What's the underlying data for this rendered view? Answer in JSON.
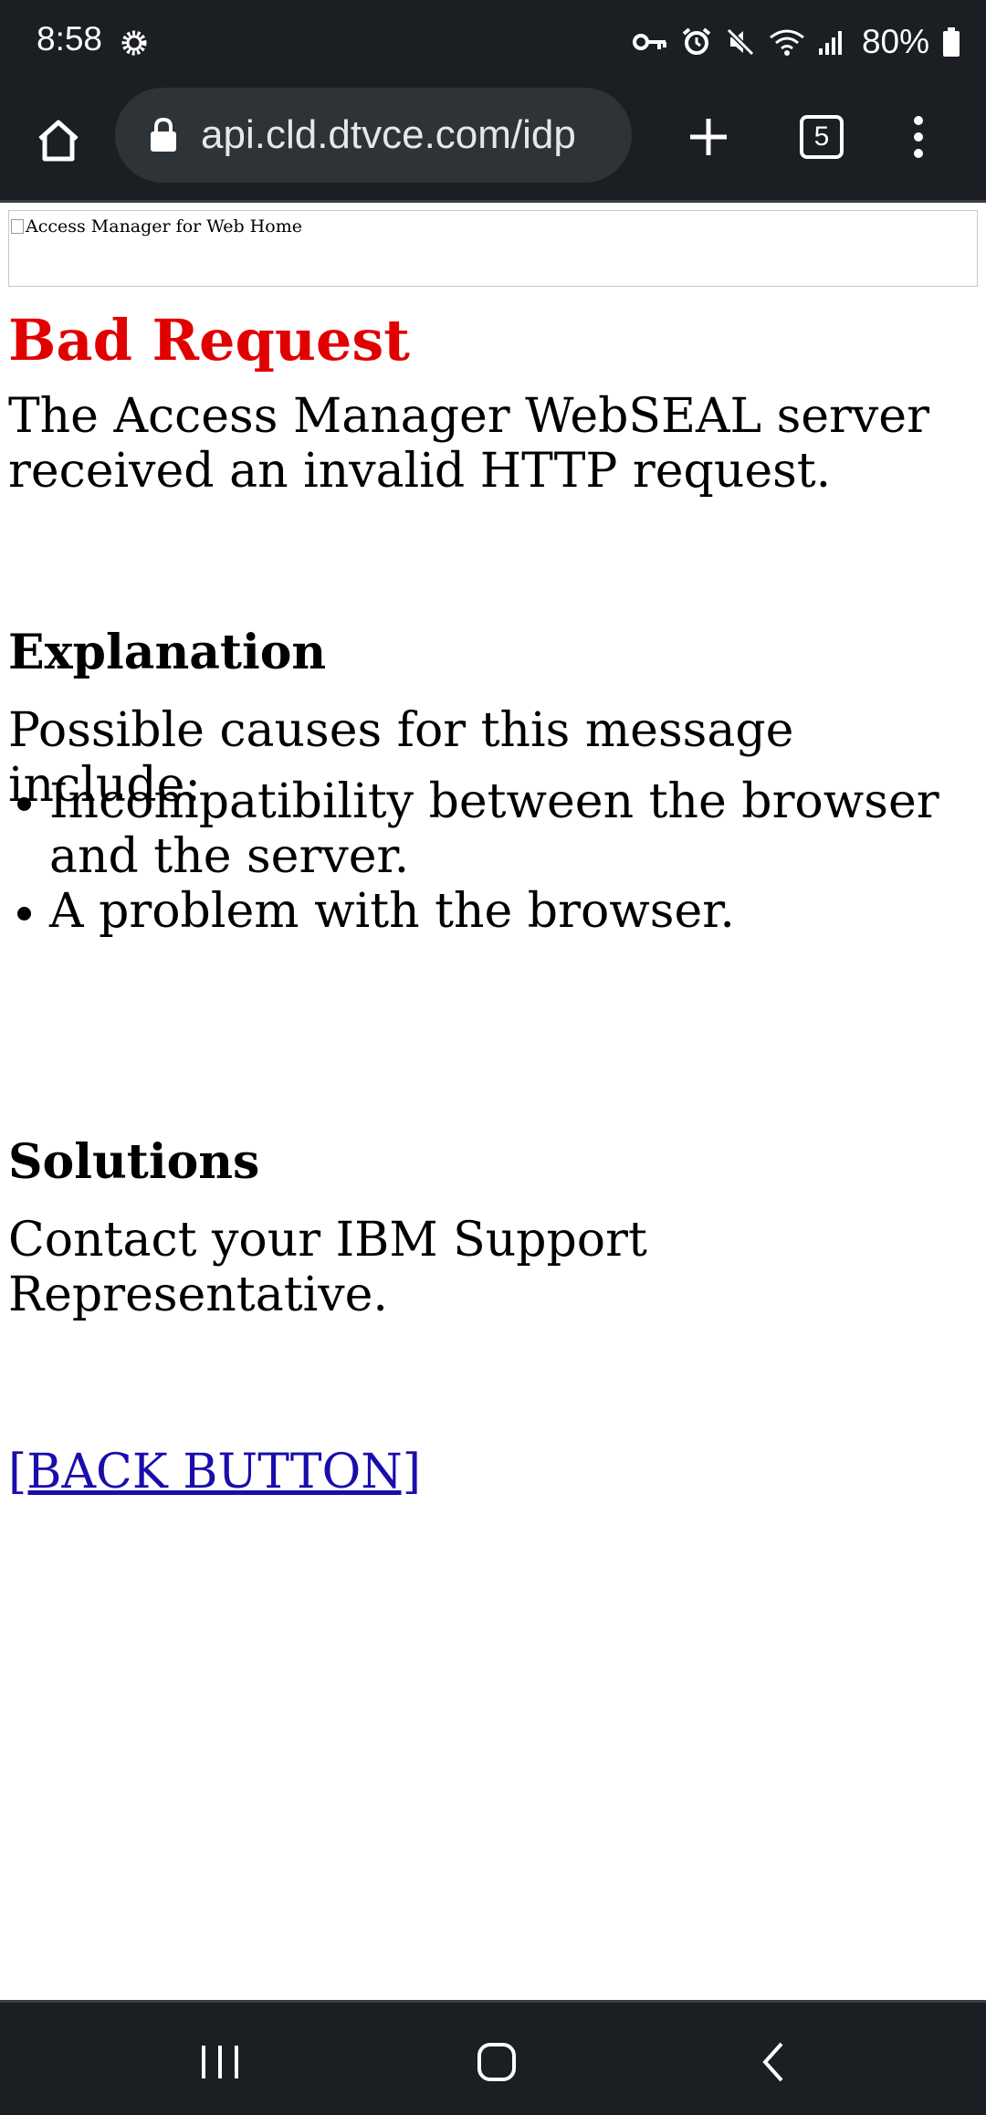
{
  "status_bar": {
    "time": "8:58",
    "battery": "80%",
    "icons": [
      "settings-gear-icon",
      "vpn-key-icon",
      "alarm-icon",
      "mute-icon",
      "wifi-icon",
      "signal-icon",
      "battery-icon"
    ]
  },
  "browser": {
    "url": "api.cld.dtvce.com/idp",
    "tab_count": "5"
  },
  "page": {
    "banner_alt": "Access Manager for Web Home",
    "title": "Bad Request",
    "title_color": "#e10000",
    "intro": "The Access Manager WebSEAL server received an invalid HTTP request.",
    "explanation_heading": "Explanation",
    "causes_intro": "Possible causes for this message include:",
    "causes": [
      "Incompatibility between the browser and the server.",
      "A problem with the browser."
    ],
    "solutions_heading": "Solutions",
    "solution_text": "Contact your IBM Support Representative.",
    "back_link": "[BACK BUTTON]",
    "link_color": "#1a0dab"
  }
}
